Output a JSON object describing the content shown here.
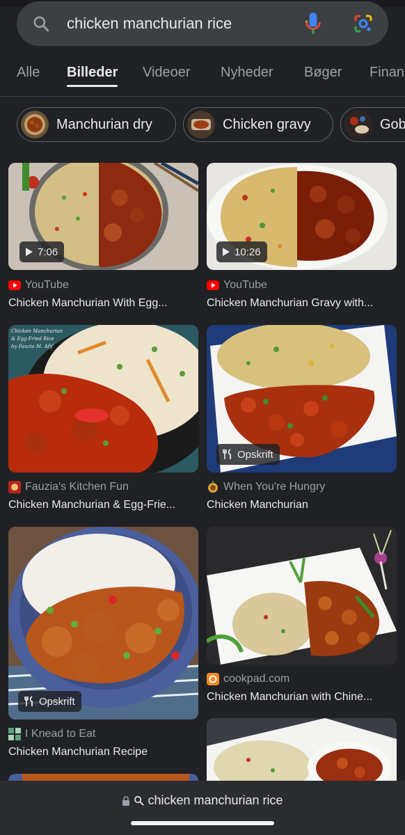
{
  "search": {
    "query": "chicken manchurian rice"
  },
  "tabs": [
    {
      "label": "Alle"
    },
    {
      "label": "Billeder",
      "active": true
    },
    {
      "label": "Videoer"
    },
    {
      "label": "Nyheder"
    },
    {
      "label": "Bøger"
    },
    {
      "label": "Finan"
    }
  ],
  "chips": [
    {
      "label": "Manchurian dry"
    },
    {
      "label": "Chicken gravy"
    },
    {
      "label": "Gob"
    }
  ],
  "results": [
    {
      "source": "YouTube",
      "title": "Chicken Manchurian With Egg...",
      "badge": "7:06",
      "badge_type": "video",
      "source_icon": "youtube-icon"
    },
    {
      "source": "YouTube",
      "title": "Chicken Manchurian Gravy with...",
      "badge": "10:26",
      "badge_type": "video",
      "source_icon": "youtube-icon"
    },
    {
      "source": "Fauzia's Kitchen Fun",
      "title": "Chicken Manchurian & Egg-Frie...",
      "badge": "",
      "source_icon": "fauzia-icon",
      "image_caption": "Chicken Manchurian & Egg-Fried Rice by Fauzia M. Afif"
    },
    {
      "source": "When You're Hungry",
      "title": "Chicken Manchurian",
      "badge": "Opskrift",
      "badge_type": "recipe",
      "source_icon": "hungry-icon"
    },
    {
      "source": "I Knead to Eat",
      "title": "Chicken Manchurian Recipe",
      "badge": "Opskrift",
      "badge_type": "recipe",
      "source_icon": "knead-icon"
    },
    {
      "source": "cookpad.com",
      "title": "Chicken Manchurian with Chine...",
      "badge": "",
      "source_icon": "cookpad-icon"
    }
  ],
  "address_bar": {
    "url": "chicken manchurian rice"
  },
  "colors": {
    "background": "#202124",
    "search_bar": "#3c4043",
    "text_primary": "#e8eaed",
    "text_secondary": "#9aa0a6",
    "youtube_red": "#ff0000",
    "google_blue": "#4285f4",
    "google_red": "#ea4335",
    "google_yellow": "#fbbc04",
    "google_green": "#34a853"
  }
}
